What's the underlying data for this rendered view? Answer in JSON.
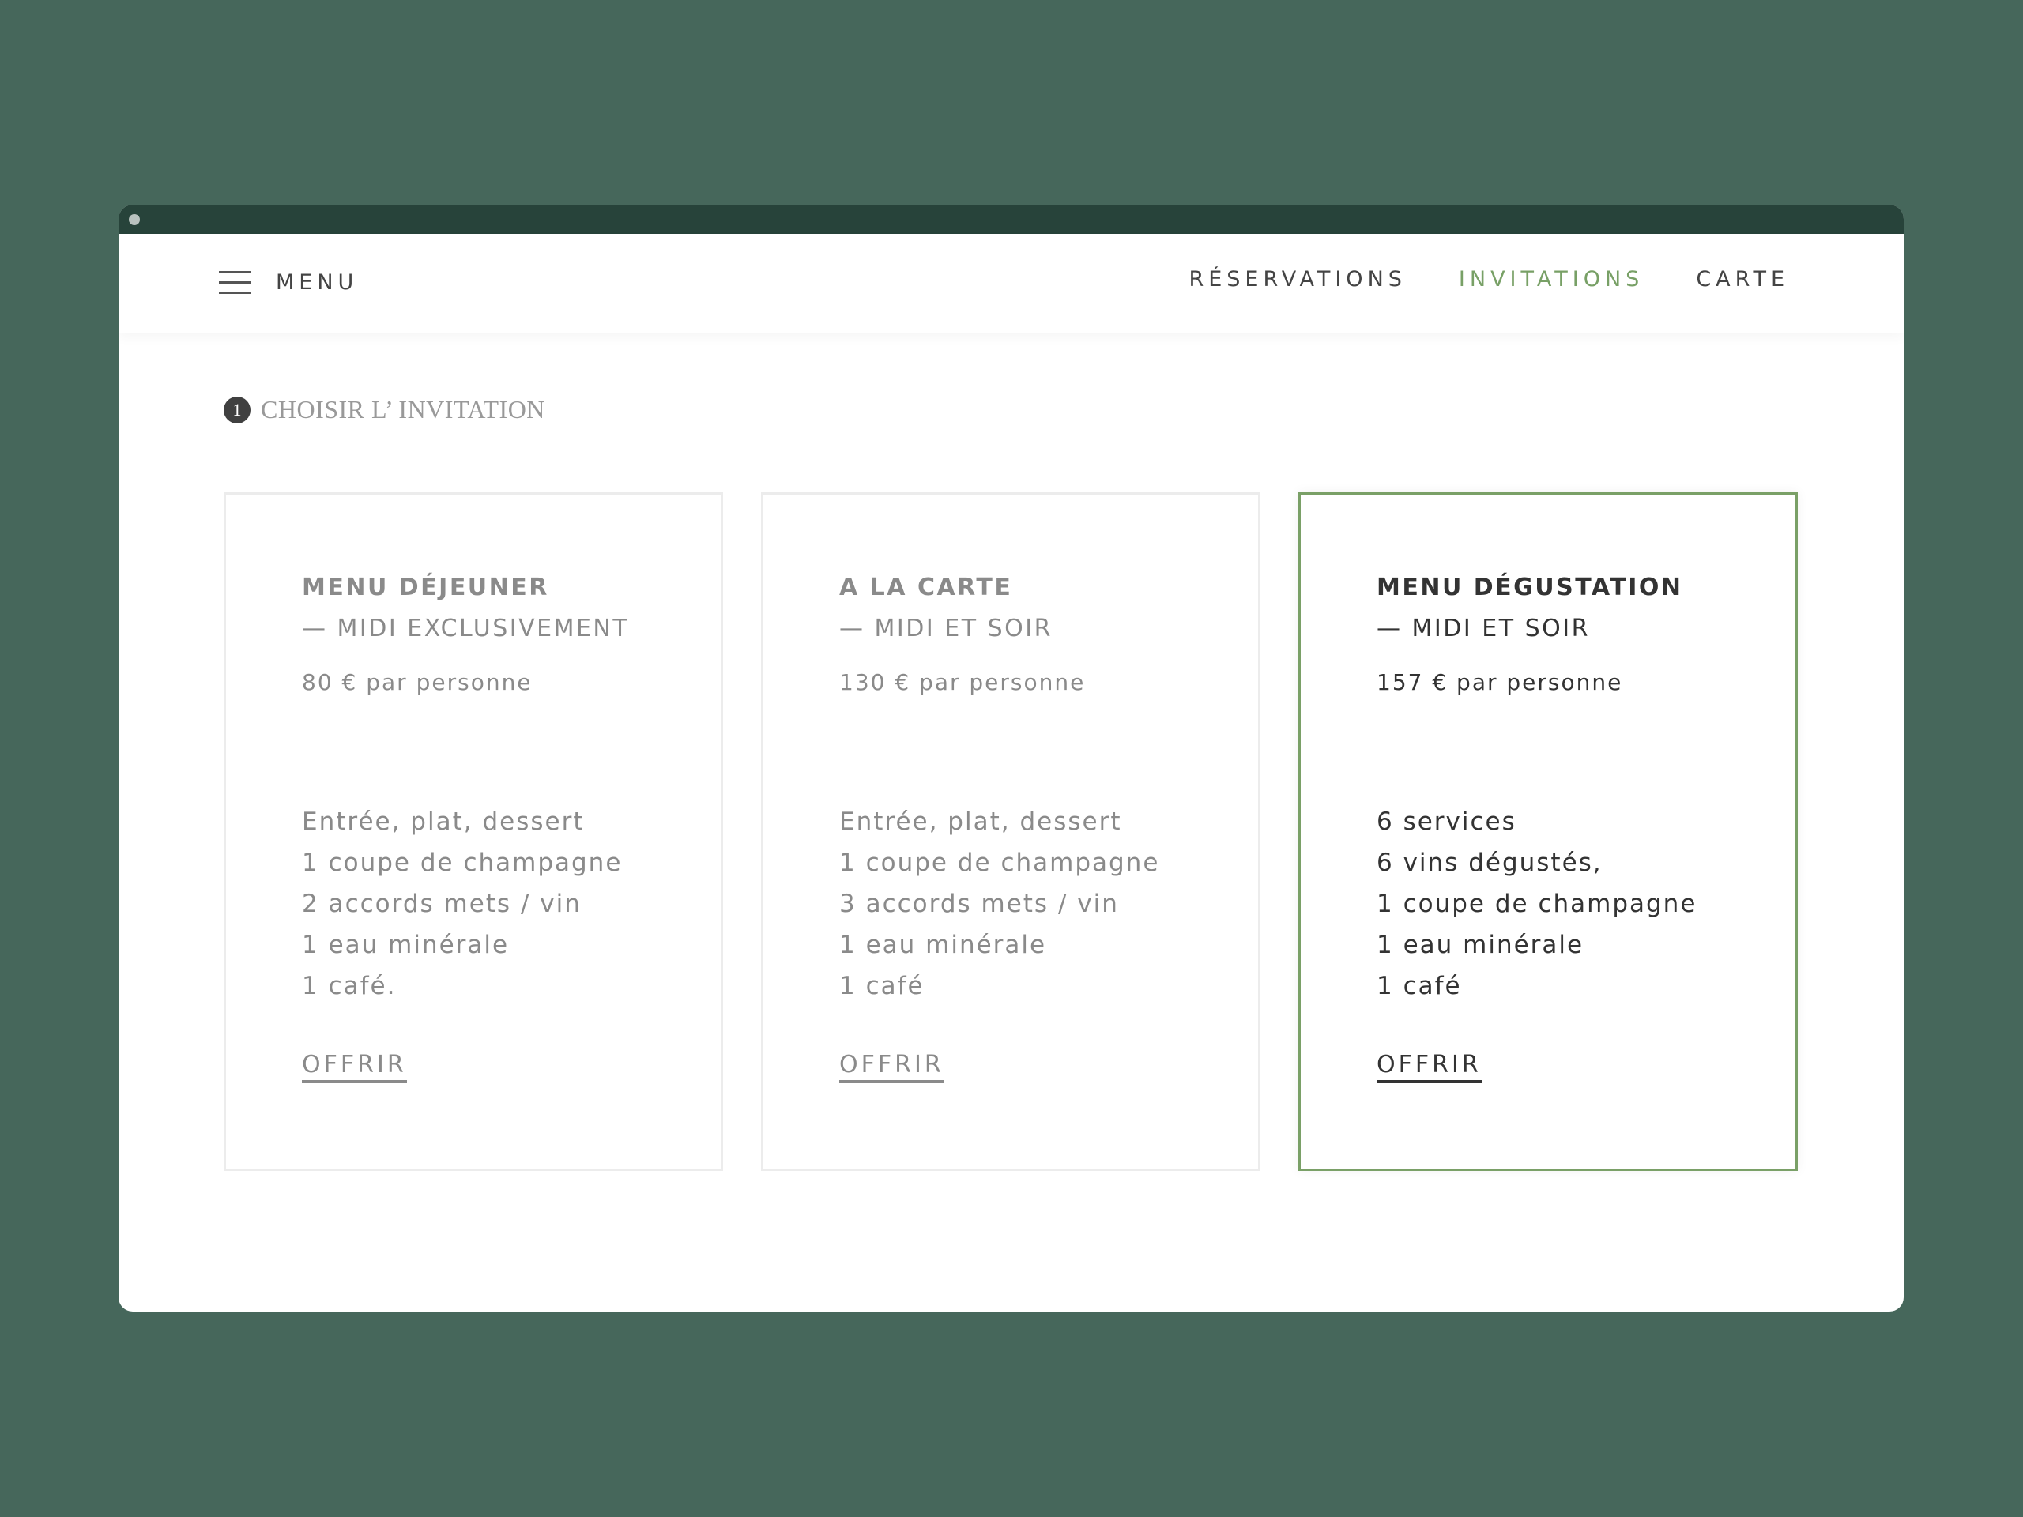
{
  "header": {
    "menu_label": "MENU",
    "nav": [
      {
        "label": "RÉSERVATIONS",
        "active": false
      },
      {
        "label": "INVITATIONS",
        "active": true
      },
      {
        "label": "CARTE",
        "active": false
      }
    ]
  },
  "step": {
    "number": "1",
    "label": "CHOISIR L’ INVITATION"
  },
  "cards": [
    {
      "title": "MENU DÉJEUNER",
      "subtitle": "— MIDI EXCLUSIVEMENT",
      "price": "80 € par personne",
      "features": [
        "Entrée, plat, dessert",
        "1 coupe de champagne",
        "2 accords mets / vin",
        "1 eau minérale",
        "1 café."
      ],
      "action": "OFFRIR",
      "selected": false
    },
    {
      "title": "A LA CARTE",
      "subtitle": "— MIDI ET SOIR",
      "price": "130 € par personne",
      "features": [
        "Entrée, plat, dessert",
        "1 coupe de champagne",
        "3 accords mets / vin",
        "1 eau minérale",
        "1 café"
      ],
      "action": "OFFRIR",
      "selected": false
    },
    {
      "title": "MENU DÉGUSTATION",
      "subtitle": "— MIDI ET SOIR",
      "price": "157 € par personne",
      "features": [
        "6 services",
        "6 vins dégustés,",
        "1 coupe de champagne",
        "1 eau minérale",
        "1 café"
      ],
      "action": "OFFRIR",
      "selected": true
    }
  ],
  "colors": {
    "accent": "#78a066",
    "background": "#46675b",
    "titlebar": "#27433a"
  }
}
